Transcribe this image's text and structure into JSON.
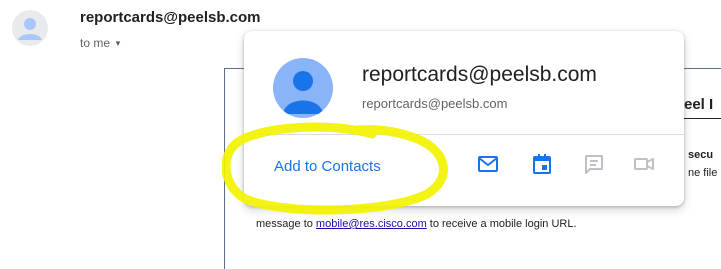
{
  "header": {
    "sender_email": "reportcards@peelsb.com",
    "recipient_label": "to me",
    "recipient_caret_icon": "caret-down-icon"
  },
  "email_body": {
    "heading_fragment": "eel I",
    "secure_fragment": "secu",
    "file_fragment": "ne file",
    "message_prefix": "message to ",
    "message_link": "mobile@res.cisco.com",
    "message_suffix": " to receive a mobile login URL."
  },
  "contact_card": {
    "name": "reportcards@peelsb.com",
    "email": "reportcards@peelsb.com",
    "add_to_contacts_label": "Add to Contacts",
    "actions": [
      {
        "icon": "mail-icon",
        "color": "#1a73e8"
      },
      {
        "icon": "calendar-icon",
        "color": "#1a73e8"
      },
      {
        "icon": "chat-icon",
        "color": "#bdc1c6"
      },
      {
        "icon": "video-icon",
        "color": "#bdc1c6"
      }
    ]
  },
  "colors": {
    "accent": "#1a73e8",
    "highlight": "#f2f200",
    "avatar_card": "#8ab4f8",
    "avatar_person": "#1a73e8",
    "avatar_header": "#e8eaed"
  }
}
